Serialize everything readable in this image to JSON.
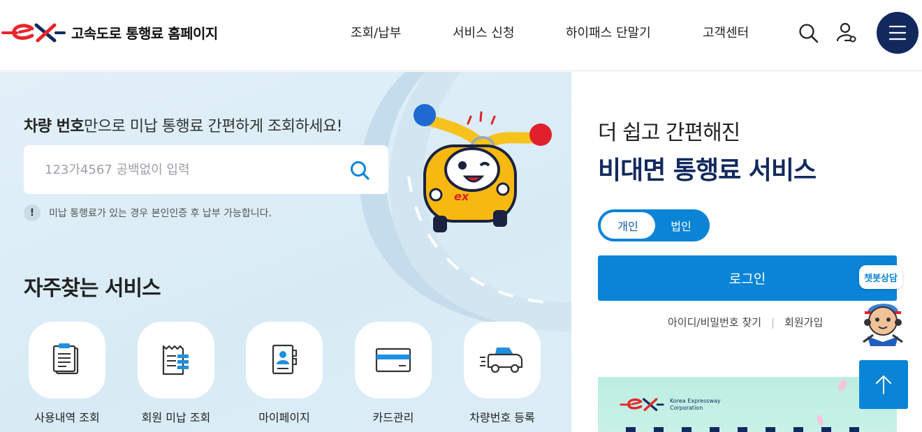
{
  "header": {
    "site_title": "고속도로 통행료 홈페이지",
    "nav": [
      "조회/납부",
      "서비스 신청",
      "하이패스 단말기",
      "고객센터"
    ],
    "icons": [
      "search-icon",
      "user-icon",
      "menu-icon"
    ]
  },
  "search": {
    "title_bold": "차량 번호",
    "title_rest": "만으로 미납 통행료 간편하게 조회하세요!",
    "placeholder": "123가4567 공백없이 입력",
    "notice_icon": "!",
    "notice": "미납 통행료가 있는 경우 본인인증 후 납부 가능합니다."
  },
  "favorites": {
    "title": "자주찾는 서비스",
    "items": [
      {
        "label": "사용내역 조회",
        "icon": "clipboard-icon"
      },
      {
        "label": "회원 미납 조회",
        "icon": "receipt-icon"
      },
      {
        "label": "마이페이지",
        "icon": "profile-card-icon"
      },
      {
        "label": "카드관리",
        "icon": "credit-card-icon"
      },
      {
        "label": "차량번호 등록",
        "icon": "car-icon"
      }
    ]
  },
  "login_panel": {
    "subtitle": "더 쉽고 간편해진",
    "title": "비대면 통행료 서비스",
    "toggle": {
      "personal": "개인",
      "corporate": "법인",
      "selected": "개인"
    },
    "login_label": "로그인",
    "find_account": "아이디/비밀번호 찾기",
    "signup": "회원가입"
  },
  "banner": {
    "corp_name_line1": "Korea Expressway",
    "corp_name_line2": "Corporation"
  },
  "chatbot": {
    "label": "챗봇상담"
  },
  "colors": {
    "primary": "#0a84d6",
    "navy": "#13295e",
    "brand_red": "#e8262c",
    "panel_bg": "#dcedf6"
  }
}
